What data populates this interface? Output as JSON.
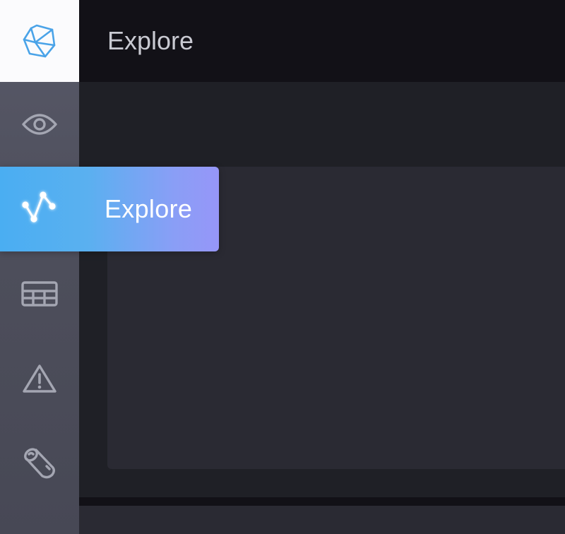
{
  "header": {
    "title": "Explore"
  },
  "sidebar": {
    "logo_icon": "polyhedron-logo-icon",
    "items": [
      {
        "icon": "eye-icon",
        "label": ""
      },
      {
        "icon": "explore-graph-icon",
        "label": "Explore",
        "active": true
      },
      {
        "icon": "table-icon",
        "label": ""
      },
      {
        "icon": "warning-icon",
        "label": ""
      },
      {
        "icon": "log-icon",
        "label": ""
      }
    ]
  },
  "colors": {
    "accent_start": "#4aaef2",
    "accent_end": "#9696f8",
    "logo_blue": "#4aa3e8",
    "icon_gray": "#a4a6b2",
    "background": "#121117",
    "panel": "#2a2a33"
  }
}
